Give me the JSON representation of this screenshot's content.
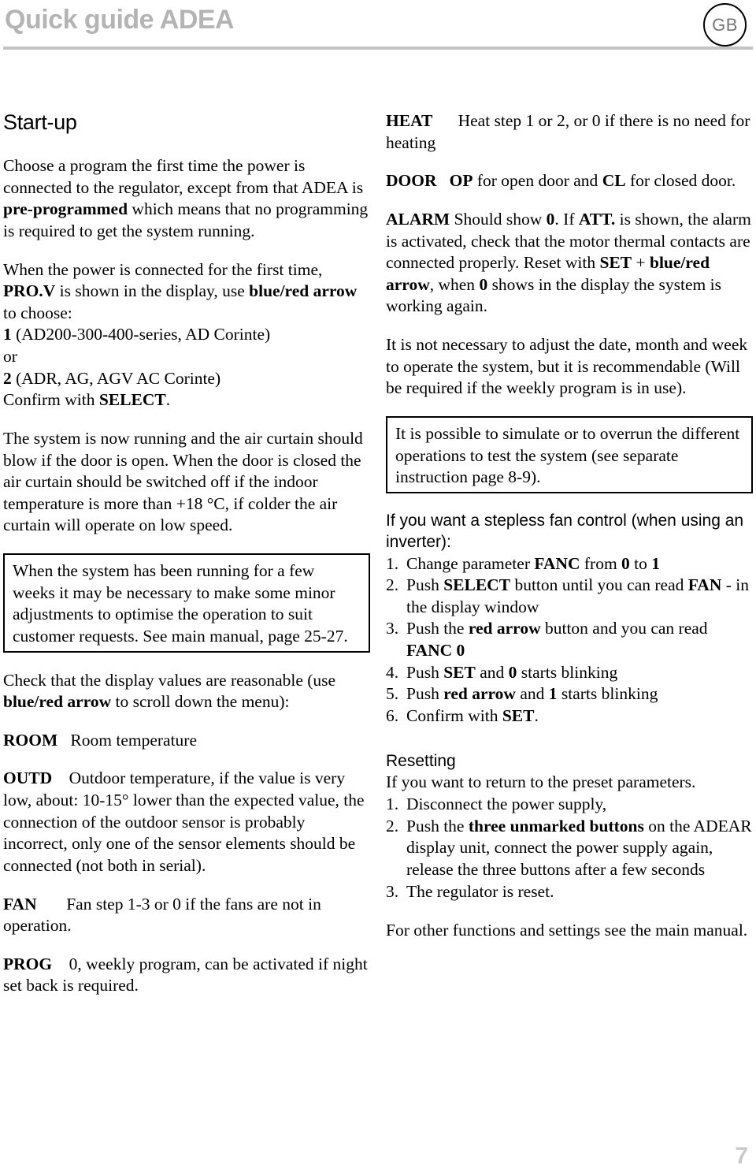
{
  "header": {
    "title": "Quick guide ADEA",
    "language_badge": "GB",
    "rule_color": "#c4c4c4",
    "title_color": "#b4b4b4"
  },
  "left_column": {
    "heading": "Start-up",
    "intro_paragraph": {
      "part1": "Choose a program the first time the power is connected to the regulator, except from that ADEA is ",
      "bold1": "pre-programmed",
      "part2": " which means that no programming is required to get the system running."
    },
    "power_paragraph": {
      "part1": "When the power is connected for the first time, ",
      "bold1": "PRO.V",
      "part2": " is shown in the display, use ",
      "bold2": "blue/red arrow",
      "part3": " to choose:"
    },
    "option_1": {
      "bold": "1",
      "text": " (AD200-300-400-series, AD Corinte)"
    },
    "option_or": "or",
    "option_2": {
      "bold": "2",
      "text": " (ADR, AG, AGV AC Corinte)"
    },
    "confirm_line": {
      "text": "Confirm with ",
      "bold": "SELECT",
      "after": "."
    },
    "running_paragraph": "The system is now running and the air curtain should blow if the door is open. When the door is closed the air curtain should be switched off if the indoor temperature is more than +18 °C, if colder the air curtain will operate on low speed.",
    "boxed_note": "When the system has been running for a few weeks it may be necessary to make some minor adjustments to optimise the operation to suit customer requests. See main manual, page 25-27.",
    "check_paragraph": {
      "part1": "Check that the display values are reasonable (use ",
      "bold1": "blue/red arrow",
      "part2": " to scroll down the menu):"
    },
    "parameters": [
      {
        "code": "ROOM",
        "description": "Room temperature"
      },
      {
        "code": "OUTD",
        "description": "Outdoor temperature, if the value is very low, about: 10-15° lower than the expected value, the connection of the outdoor sensor is probably incorrect, only one of the sensor elements should be connected (not both in serial)."
      },
      {
        "code": "FAN",
        "description": "Fan step 1-3 or 0 if the fans are not in operation."
      },
      {
        "code": "PROG",
        "description": "0, weekly program, can be activated if night set back is required."
      }
    ]
  },
  "right_column": {
    "parameters": [
      {
        "code": "HEAT",
        "description": "Heat step 1 or 2,  or 0 if there is no need for heating"
      }
    ],
    "door_param": {
      "code": "DOOR",
      "bold1": "OP",
      "mid": " for open door and ",
      "bold2": "CL",
      "end": " for closed door."
    },
    "alarm_param": {
      "code": "ALARM",
      "part1": " Should show ",
      "bold1": "0",
      "part2": ". If ",
      "bold2": "ATT.",
      "part3": " is shown, the alarm is activated, check that the motor thermal contacts are connected properly. Reset with ",
      "bold3": "SET",
      "part4": " + ",
      "bold4": "blue/red arrow",
      "part5": ", when ",
      "bold5": "0",
      "part6": " shows in the display the system is working again."
    },
    "date_paragraph": "It is not necessary to adjust the date, month and week to operate the system, but it is recommendable (Will be required if the weekly program is in use).",
    "boxed_note": "It is possible to simulate or to overrun the different operations to test the system (see separate instruction page 8-9).",
    "stepless_heading": "If you want a stepless fan control (when using an inverter):",
    "stepless_steps": [
      {
        "num": "1.",
        "p1": "Change parameter ",
        "b1": "FANC",
        "p2": " from ",
        "b2": "0",
        "p3": " to ",
        "b3": "1",
        "p4": ""
      },
      {
        "num": "2.",
        "p1": "Push ",
        "b1": "SELECT",
        "p2": " button until you can read ",
        "b2": "FAN",
        "p3": "  - in the display window",
        "p4": ""
      },
      {
        "num": "3.",
        "p1": "Push the ",
        "b1": "red arrow",
        "p2": " button and you can read ",
        "b2": "FANC",
        "p3": "  ",
        "b3": "0",
        "p4": ""
      },
      {
        "num": "4.",
        "p1": "Push ",
        "b1": "SET",
        "p2": " and ",
        "b2": "0",
        "p3": " starts blinking",
        "p4": ""
      },
      {
        "num": "5.",
        "p1": "Push ",
        "b1": "red arrow",
        "p2": " and ",
        "b2": "1",
        "p3": " starts blinking",
        "p4": ""
      },
      {
        "num": "6.",
        "p1": "Confirm with ",
        "b1": "SET",
        "p2": ".",
        "p3": "",
        "p4": ""
      }
    ],
    "resetting_heading": "Resetting",
    "resetting_intro": "If you want to return to the preset parameters.",
    "resetting_steps": [
      {
        "num": "1.",
        "p1": "Disconnect the power supply,",
        "b1": "",
        "p2": ""
      },
      {
        "num": "2.",
        "p1": "Push the ",
        "b1": "three unmarked buttons",
        "p2": " on the ADEAR display unit, connect the power supply again, release the three buttons after a few seconds"
      },
      {
        "num": "3.",
        "p1": "The regulator is reset.",
        "b1": "",
        "p2": ""
      }
    ],
    "closing_paragraph": "For other functions and settings see the main manual."
  },
  "footer": {
    "page_number": "7"
  }
}
